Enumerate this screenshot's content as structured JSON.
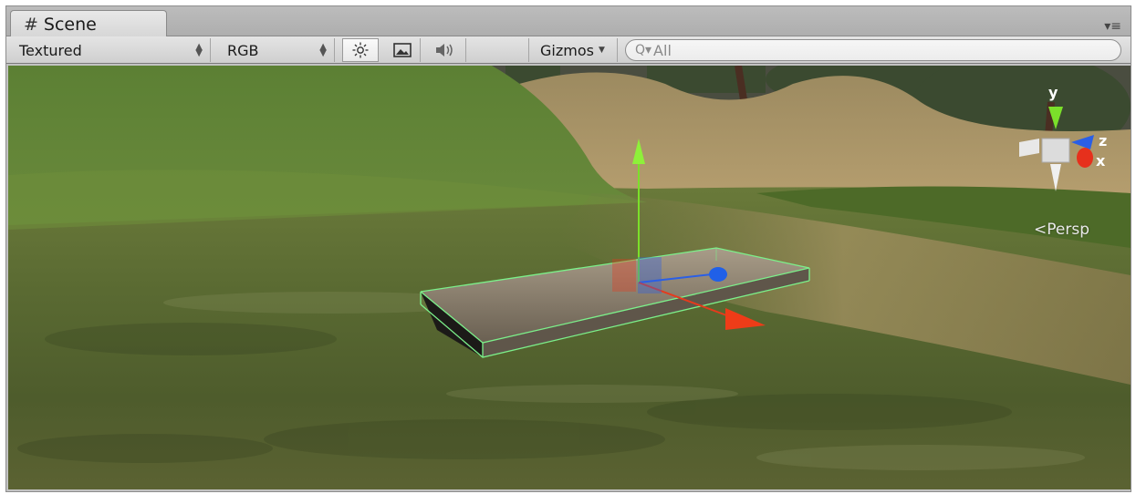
{
  "window": {
    "tab_icon": "#",
    "tab_title": "Scene",
    "menu_icon": "▾≡"
  },
  "toolbar": {
    "draw_mode": "Textured",
    "render_mode": "RGB",
    "lighting_icon": "sun-icon",
    "image_icon": "image-icon",
    "audio_icon": "speaker-icon",
    "gizmos_label": "Gizmos",
    "search_placeholder": "All"
  },
  "viewport": {
    "projection_label": "Persp",
    "gizmo_axes": {
      "y": "y",
      "z": "z",
      "x": "x"
    }
  },
  "colors": {
    "x_axis": "#e63a1c",
    "y_axis": "#7be02a",
    "z_axis": "#2a5fe6",
    "selection_outline": "#7cf08a"
  }
}
